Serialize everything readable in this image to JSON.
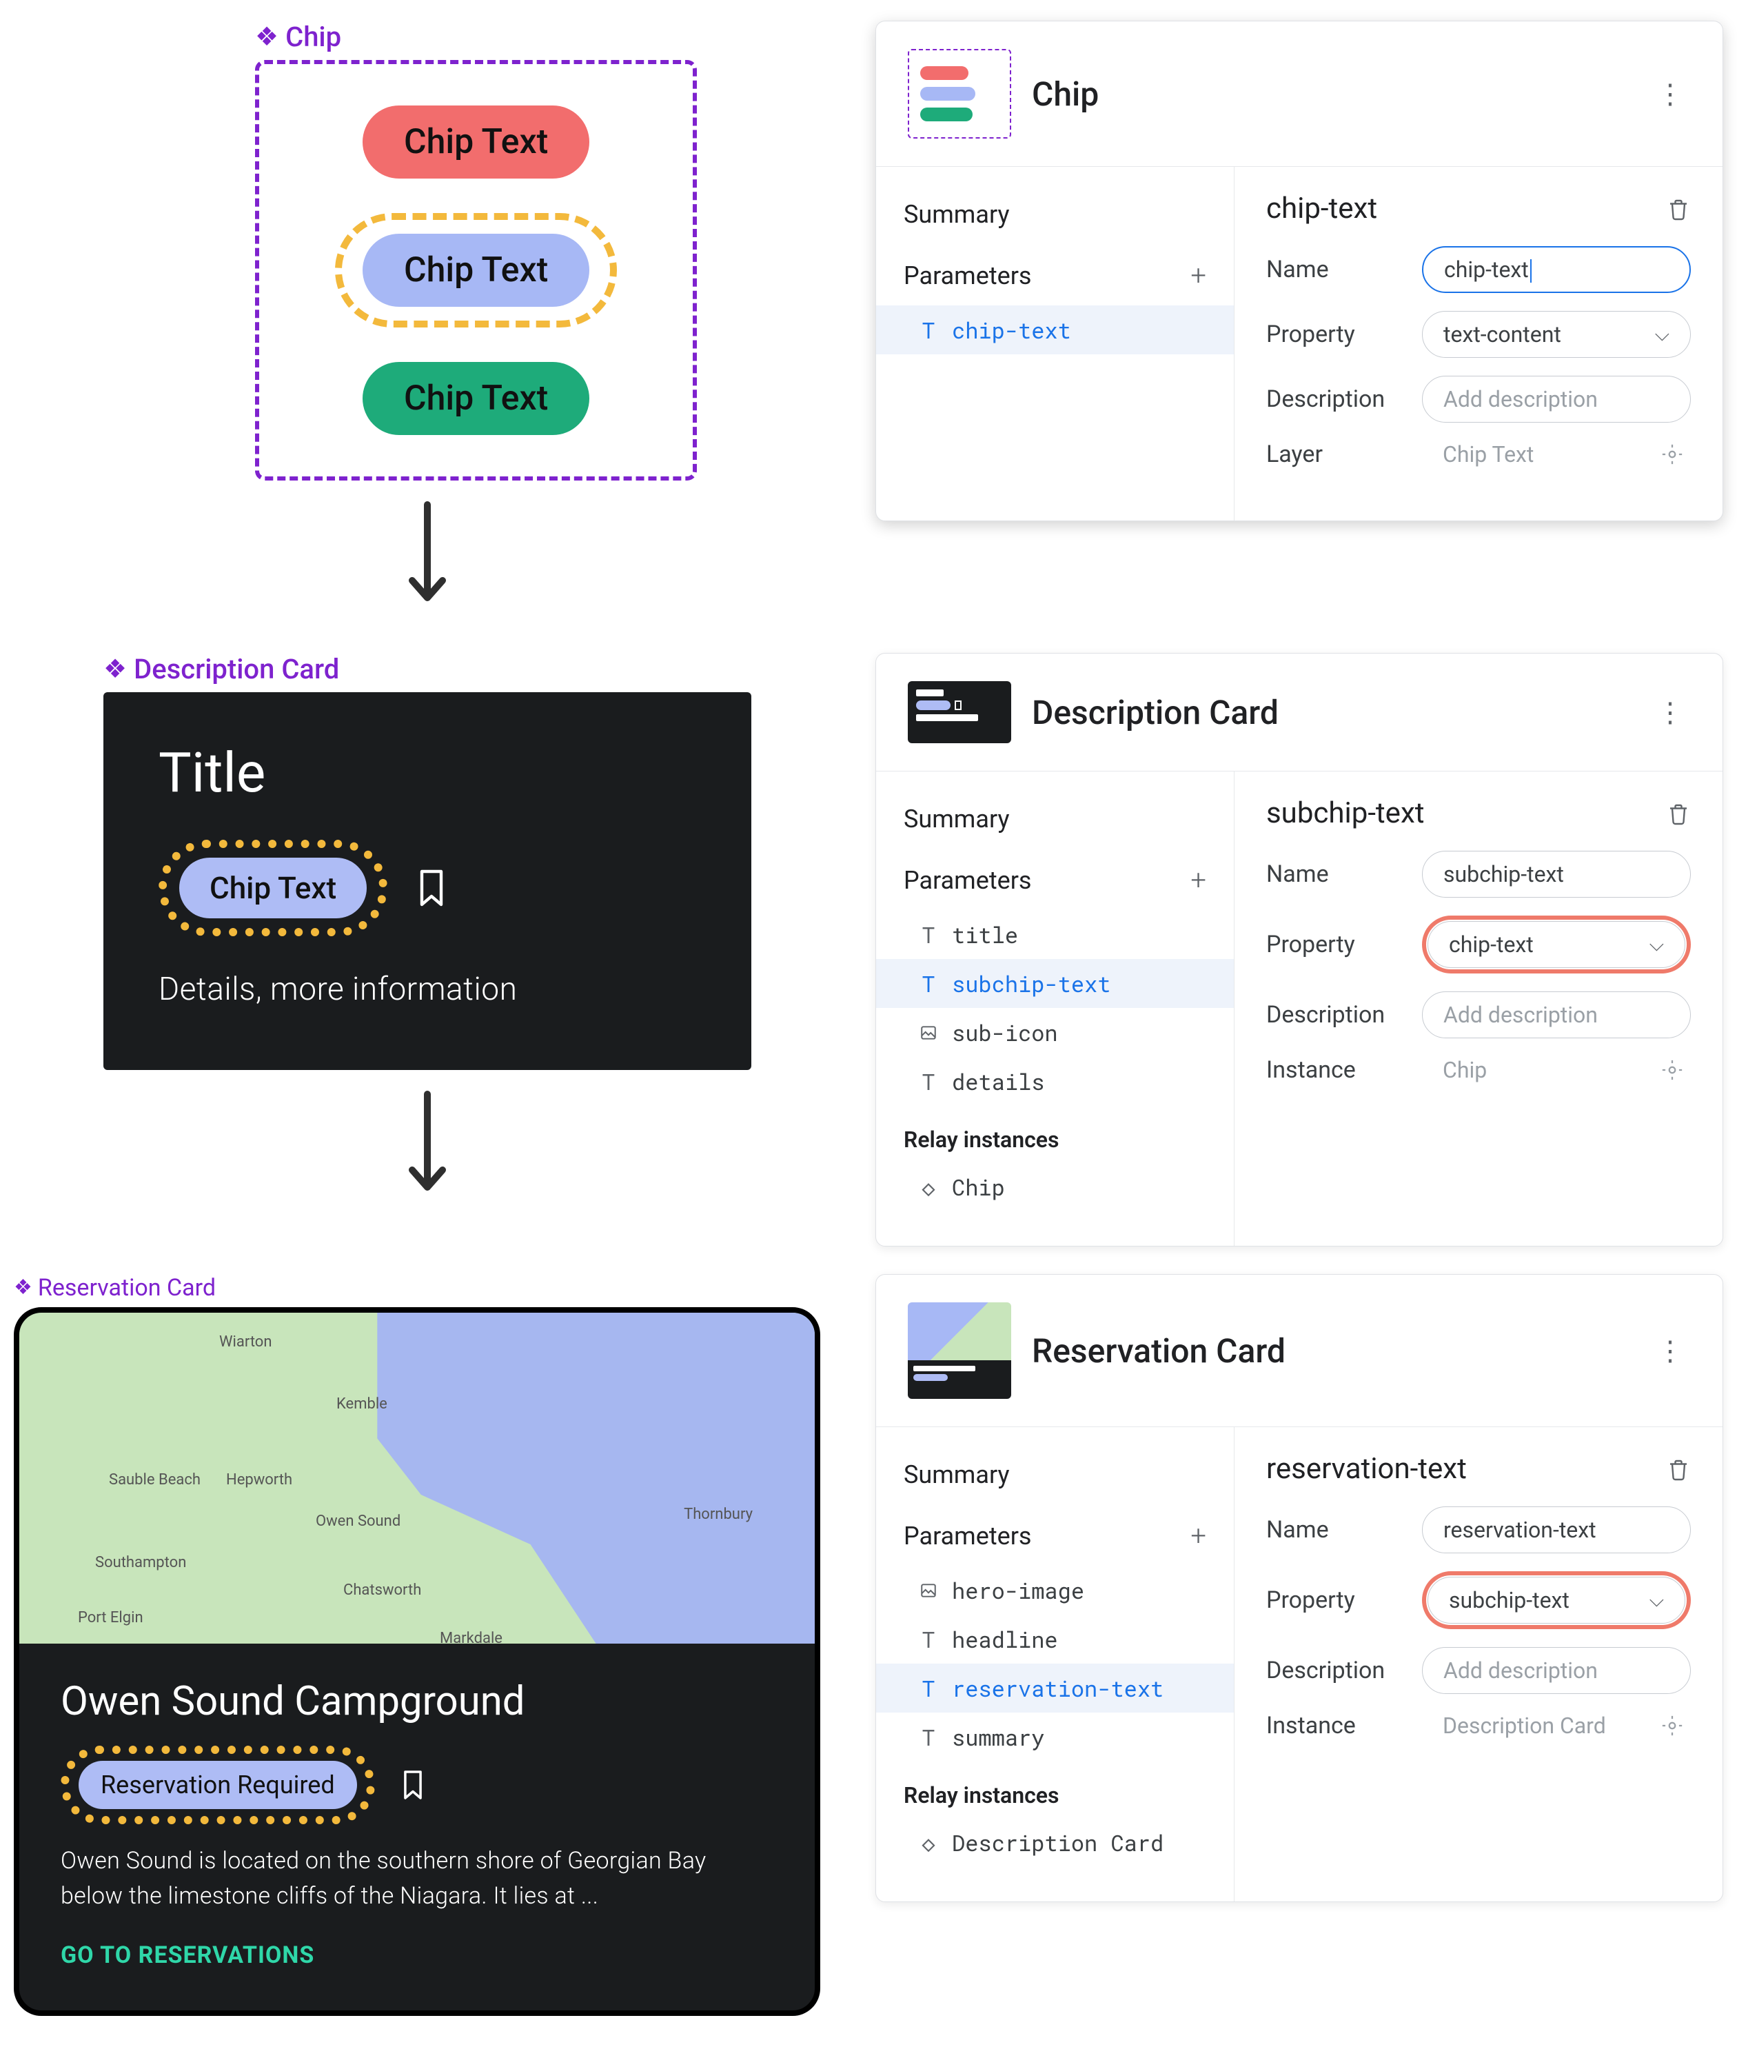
{
  "chip_section": {
    "component_label": "Chip",
    "chips": [
      "Chip Text",
      "Chip Text",
      "Chip Text"
    ],
    "panel": {
      "title": "Chip",
      "summary_label": "Summary",
      "parameters_label": "Parameters",
      "params": [
        {
          "icon": "T",
          "name": "chip-text",
          "active": true
        }
      ],
      "detail": {
        "title": "chip-text",
        "name_label": "Name",
        "name_value": "chip-text",
        "property_label": "Property",
        "property_value": "text-content",
        "description_label": "Description",
        "description_placeholder": "Add description",
        "layer_label": "Layer",
        "layer_value": "Chip Text"
      }
    }
  },
  "desc_section": {
    "component_label": "Description Card",
    "card": {
      "title": "Title",
      "chip_text": "Chip Text",
      "details": "Details, more information"
    },
    "panel": {
      "title": "Description Card",
      "summary_label": "Summary",
      "parameters_label": "Parameters",
      "params": [
        {
          "icon": "T",
          "name": "title",
          "active": false
        },
        {
          "icon": "T",
          "name": "subchip-text",
          "active": true
        },
        {
          "icon": "img",
          "name": "sub-icon",
          "active": false
        },
        {
          "icon": "T",
          "name": "details",
          "active": false
        }
      ],
      "relay_label": "Relay instances",
      "relay_items": [
        {
          "icon": "diamond",
          "name": "Chip"
        }
      ],
      "detail": {
        "title": "subchip-text",
        "name_label": "Name",
        "name_value": "subchip-text",
        "property_label": "Property",
        "property_value": "chip-text",
        "description_label": "Description",
        "description_placeholder": "Add description",
        "instance_label": "Instance",
        "instance_value": "Chip"
      }
    }
  },
  "res_section": {
    "component_label": "Reservation Card",
    "card": {
      "map_labels": [
        "Wiarton",
        "Kemble",
        "Sauble Beach",
        "Hepworth",
        "Owen Sound",
        "Southampton",
        "Chatsworth",
        "Port Elgin",
        "Markdale",
        "Thornbury"
      ],
      "headline": "Owen Sound Campground",
      "chip_text": "Reservation Required",
      "summary": "Owen Sound is located on the southern shore of Georgian Bay below the limestone cliffs of the Niagara. It lies at ...",
      "cta": "GO TO RESERVATIONS"
    },
    "panel": {
      "title": "Reservation Card",
      "summary_label": "Summary",
      "parameters_label": "Parameters",
      "params": [
        {
          "icon": "img",
          "name": "hero-image",
          "active": false
        },
        {
          "icon": "T",
          "name": "headline",
          "active": false
        },
        {
          "icon": "T",
          "name": "reservation-text",
          "active": true
        },
        {
          "icon": "T",
          "name": "summary",
          "active": false
        }
      ],
      "relay_label": "Relay instances",
      "relay_items": [
        {
          "icon": "diamond",
          "name": "Description Card"
        }
      ],
      "detail": {
        "title": "reservation-text",
        "name_label": "Name",
        "name_value": "reservation-text",
        "property_label": "Property",
        "property_value": "subchip-text",
        "description_label": "Description",
        "description_placeholder": "Add description",
        "instance_label": "Instance",
        "instance_value": "Description Card"
      }
    }
  }
}
